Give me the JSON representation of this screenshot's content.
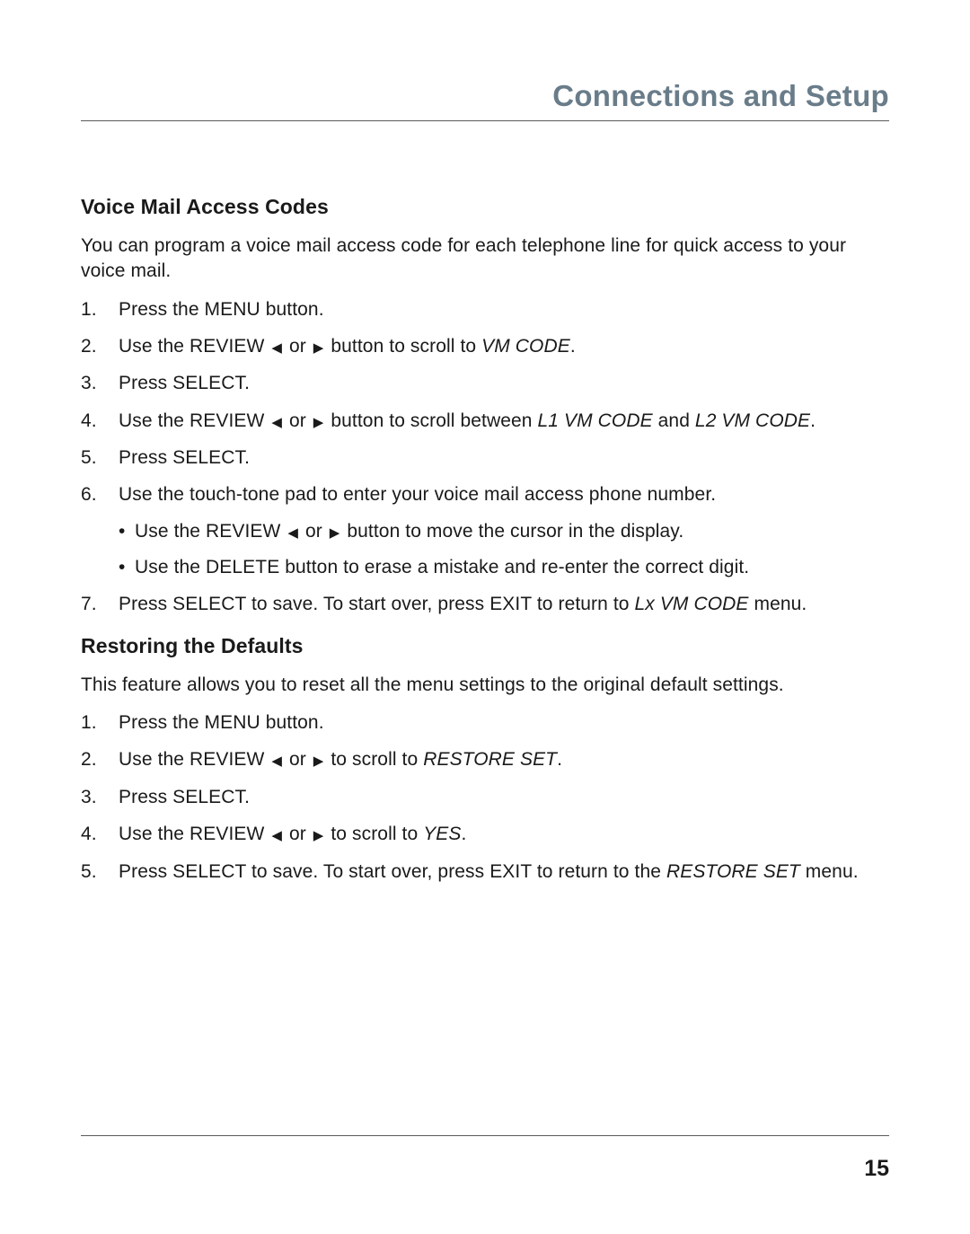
{
  "header": {
    "title": "Connections and Setup"
  },
  "section1": {
    "heading": "Voice Mail Access Codes",
    "intro": "You can program a voice mail access code for each telephone line for quick access to your voice mail.",
    "steps": {
      "s1": "Press the MENU button.",
      "s2a": "Use the REVIEW ",
      "s2b": " or ",
      "s2c": " button to scroll to ",
      "s2d": "VM CODE",
      "s2e": ".",
      "s3": "Press SELECT.",
      "s4a": "Use the REVIEW ",
      "s4b": " or ",
      "s4c": " button to scroll between ",
      "s4d": "L1 VM CODE",
      "s4e": " and ",
      "s4f": "L2 VM CODE",
      "s4g": ".",
      "s5": "Press SELECT.",
      "s6": "Use the touch-tone pad to enter your voice mail access phone number.",
      "s6b1a": "Use the REVIEW ",
      "s6b1b": " or ",
      "s6b1c": " button to move the cursor in the display.",
      "s6b2": "Use the DELETE button to erase a mistake and re-enter the correct digit.",
      "s7a": "Press SELECT to save. To start over, press EXIT to return to ",
      "s7b": "Lx VM CODE",
      "s7c": " menu."
    }
  },
  "section2": {
    "heading": "Restoring the Defaults",
    "intro": "This feature allows you to reset all the menu settings to the original default settings.",
    "steps": {
      "s1": "Press the MENU button.",
      "s2a": "Use the REVIEW ",
      "s2b": " or ",
      "s2c": " to scroll to ",
      "s2d": "RESTORE SET",
      "s2e": ".",
      "s3": "Press SELECT.",
      "s4a": "Use the REVIEW ",
      "s4b": " or ",
      "s4c": " to scroll to ",
      "s4d": "YES",
      "s4e": ".",
      "s5a": "Press SELECT to save. To start over, press EXIT to return to the ",
      "s5b": "RESTORE SET",
      "s5c": " menu."
    }
  },
  "glyphs": {
    "left": "◀",
    "right": "▶"
  },
  "footer": {
    "page": "15"
  }
}
